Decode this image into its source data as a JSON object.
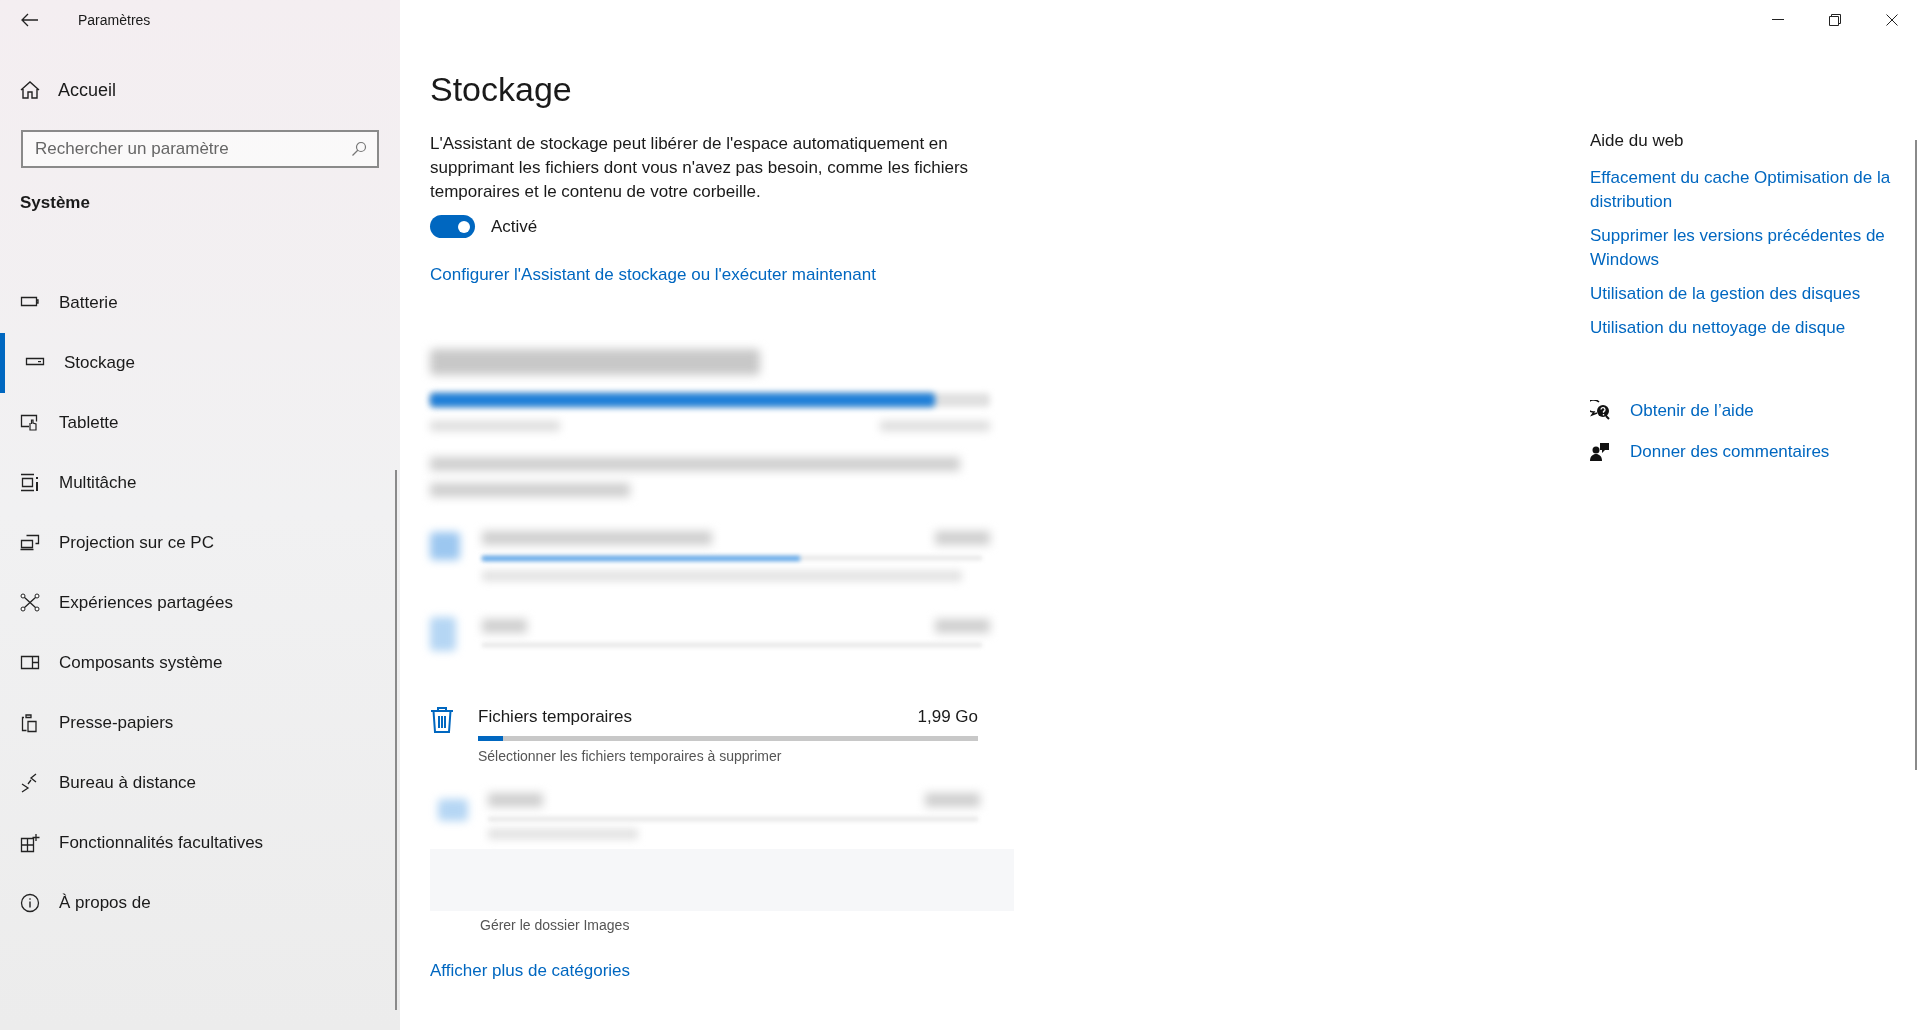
{
  "window": {
    "title": "Paramètres"
  },
  "sidebar": {
    "home": "Accueil",
    "search": {
      "placeholder": "Rechercher un paramètre"
    },
    "section": "Système",
    "items": [
      {
        "label": "Batterie",
        "selected": false
      },
      {
        "label": "Stockage",
        "selected": true
      },
      {
        "label": "Tablette",
        "selected": false
      },
      {
        "label": "Multitâche",
        "selected": false
      },
      {
        "label": "Projection sur ce PC",
        "selected": false
      },
      {
        "label": "Expériences partagées",
        "selected": false
      },
      {
        "label": "Composants système",
        "selected": false
      },
      {
        "label": "Presse-papiers",
        "selected": false
      },
      {
        "label": "Bureau à distance",
        "selected": false
      },
      {
        "label": "Fonctionnalités facultatives",
        "selected": false
      },
      {
        "label": "À propos de",
        "selected": false
      }
    ]
  },
  "page": {
    "title": "Stockage",
    "description": "L'Assistant de stockage peut libérer de l'espace automatiquement en supprimant les fichiers dont vous n'avez pas besoin, comme les fichiers temporaires et le contenu de votre corbeille.",
    "storage_sense": {
      "on": true,
      "label": "Activé"
    },
    "configure_link": "Configurer l'Assistant de stockage ou l'exécuter maintenant",
    "category": {
      "title": "Fichiers temporaires",
      "size": "1,99 Go",
      "level": 0.05,
      "subtitle": "Sélectionner les fichiers temporaires à supprimer"
    },
    "images_subtitle": "Gérer le dossier Images",
    "more_link": "Afficher plus de catégories"
  },
  "web_help": {
    "title": "Aide du web",
    "links": [
      "Effacement du cache Optimisation de la distribution",
      "Supprimer les versions précédentes de Windows",
      "Utilisation de la gestion des disques",
      "Utilisation du nettoyage de disque"
    ]
  },
  "actions": [
    "Obtenir de l’aide",
    "Donner des commentaires"
  ]
}
